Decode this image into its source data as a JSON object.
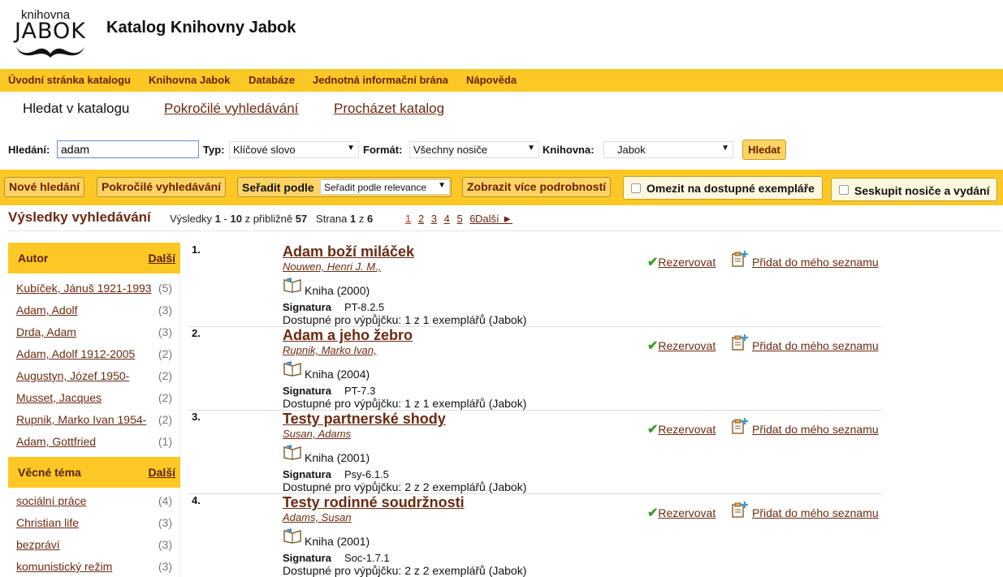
{
  "header": {
    "logo_small": "knihovna",
    "logo_big": "JABOK",
    "site_title": "Katalog Knihovny Jabok"
  },
  "topnav": [
    "Úvodní stránka katalogu",
    "Knihovna Jabok",
    "Databáze",
    "Jednotná informační brána",
    "Nápověda"
  ],
  "tabs": {
    "search": "Hledat v katalogu",
    "advanced": "Pokročilé vyhledávání",
    "browse": "Procházet katalog"
  },
  "search": {
    "label": "Hledání:",
    "value": "adam",
    "type_label": "Typ:",
    "type_value": "Klíčové slovo",
    "format_label": "Formát:",
    "format_value": "Všechny nosiče",
    "library_label": "Knihovna:",
    "library_value": "Jabok",
    "button": "Hledat"
  },
  "toolbar": {
    "new_search": "Nové hledání",
    "advanced": "Pokročilé vyhledávání",
    "sort_label": "Seřadit podle",
    "sort_value": "Seřadit podle relevance",
    "more_details": "Zobrazit více podrobností",
    "limit_available": "Omezit na dostupné exempláře",
    "group_formats": "Seskupit nosiče a vydání"
  },
  "results_header": {
    "heading": "Výsledky vyhledávání",
    "count_prefix": "Výsledky",
    "from": "1",
    "dash": "-",
    "to": "10",
    "approx": "z přibližně",
    "total": "57",
    "page_label": "Strana",
    "page": "1",
    "of": "z",
    "pages_total": "6",
    "pages": [
      "1",
      "2",
      "3",
      "4",
      "5",
      "6"
    ],
    "next": "Další ►"
  },
  "facets": {
    "author": {
      "title": "Autor",
      "more": "Další",
      "items": [
        {
          "label": "Kubíček, Jánuš 1921-1993",
          "count": "(5)"
        },
        {
          "label": "Adam, Adolf",
          "count": "(3)"
        },
        {
          "label": "Drda, Adam",
          "count": "(3)"
        },
        {
          "label": "Adam, Adolf 1912-2005",
          "count": "(2)"
        },
        {
          "label": "Augustyn, Józef 1950-",
          "count": "(2)"
        },
        {
          "label": "Musset, Jacques",
          "count": "(2)"
        },
        {
          "label": "Rupnik, Marko Ivan 1954-",
          "count": "(2)"
        },
        {
          "label": "Adam, Gottfried",
          "count": "(1)"
        }
      ]
    },
    "subject": {
      "title": "Věcné téma",
      "more": "Další",
      "items": [
        {
          "label": "sociální práce",
          "count": "(4)"
        },
        {
          "label": "Christian life",
          "count": "(3)"
        },
        {
          "label": "bezpráví",
          "count": "(3)"
        },
        {
          "label": "komunistický režim",
          "count": "(3)"
        }
      ]
    }
  },
  "results": [
    {
      "num": "1.",
      "title": "Adam boží miláček",
      "author": "Nouwen, Henri J. M.,",
      "format": "Kniha (2000)",
      "sig_label": "Signatura",
      "sig": "PT-8.2.5",
      "avail": "Dostupné pro výpůjčku: 1 z 1 exemplářů (Jabok)",
      "reserve": "Rezervovat",
      "add_list": "Přidat do mého seznamu"
    },
    {
      "num": "2.",
      "title": "Adam a jeho žebro",
      "author": "Rupnik, Marko Ivan,",
      "format": "Kniha (2004)",
      "sig_label": "Signatura",
      "sig": "PT-7.3",
      "avail": "Dostupné pro výpůjčku: 1 z 1 exemplářů (Jabok)",
      "reserve": "Rezervovat",
      "add_list": "Přidat do mého seznamu"
    },
    {
      "num": "3.",
      "title": "Testy partnerské shody",
      "author": "Susan, Adams",
      "format": "Kniha (2001)",
      "sig_label": "Signatura",
      "sig": "Psy-6.1.5",
      "avail": "Dostupné pro výpůjčku: 2 z 2 exemplářů (Jabok)",
      "reserve": "Rezervovat",
      "add_list": "Přidat do mého seznamu"
    },
    {
      "num": "4.",
      "title": "Testy rodinné soudržnosti",
      "author": "Adams, Susan",
      "format": "Kniha (2001)",
      "sig_label": "Signatura",
      "sig": "Soc-1.7.1",
      "avail": "Dostupné pro výpůjčku: 2 z 2 exemplářů (Jabok)",
      "reserve": "Rezervovat",
      "add_list": "Přidat do mého seznamu"
    }
  ],
  "colors": {
    "accent_yellow": "#fdc825",
    "link_brown": "#6b2a10",
    "check_green": "#3c9a2c"
  }
}
